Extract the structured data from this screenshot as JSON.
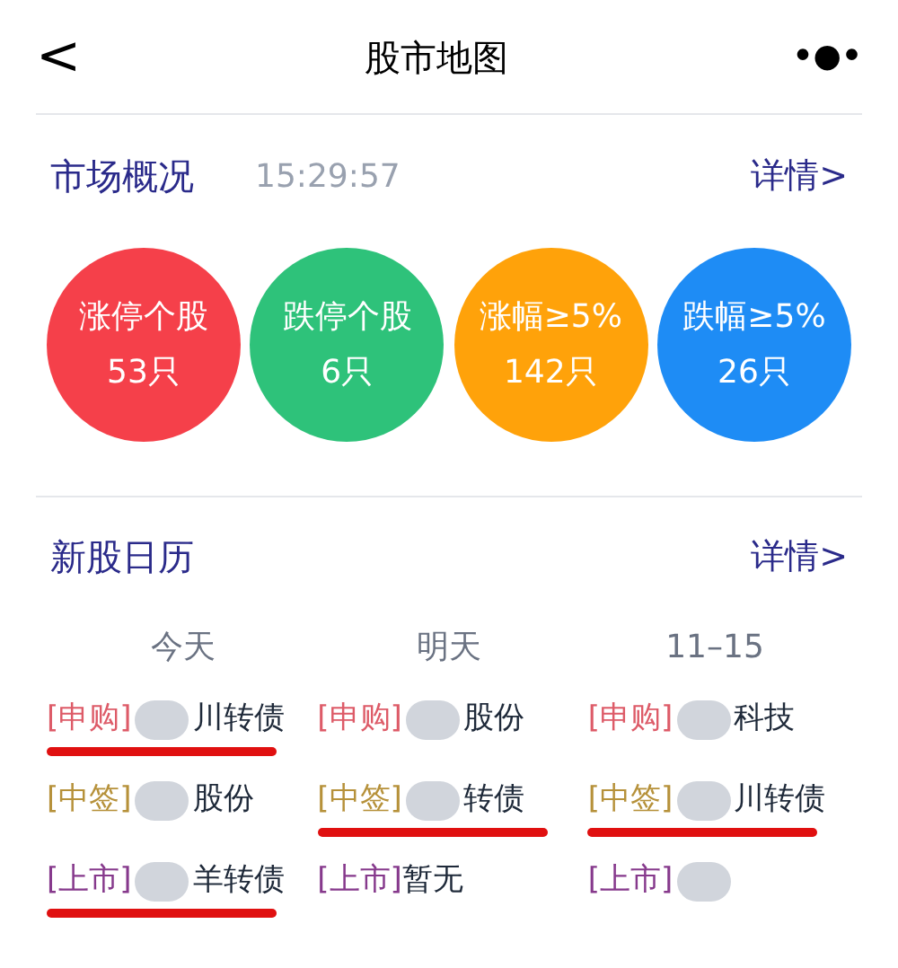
{
  "header": {
    "back": "<",
    "title": "股市地图",
    "more": "•●•"
  },
  "market": {
    "title": "市场概况",
    "time": "15:29:57",
    "detail": "详情>",
    "stats": [
      {
        "label": "涨停个股",
        "count": "53只",
        "color": "#f5404a"
      },
      {
        "label": "跌停个股",
        "count": "6只",
        "color": "#2ec27a"
      },
      {
        "label": "涨幅≥5%",
        "count": "142只",
        "color": "#ffa20a"
      },
      {
        "label": "跌幅≥5%",
        "count": "26只",
        "color": "#1e8cf5"
      }
    ]
  },
  "calendar": {
    "title": "新股日历",
    "detail": "详情>",
    "columns": [
      "今天",
      "明天",
      "11–15"
    ],
    "rows": [
      [
        {
          "tag": "[申购]",
          "color": "#dd5b68",
          "redacted": true,
          "name": "川转债",
          "underlined": true
        },
        {
          "tag": "[申购]",
          "color": "#dd5b68",
          "redacted": true,
          "name": "股份",
          "underlined": false
        },
        {
          "tag": "[申购]",
          "color": "#dd5b68",
          "redacted": true,
          "name": "科技",
          "underlined": false
        }
      ],
      [
        {
          "tag": "[中签]",
          "color": "#b6913a",
          "redacted": true,
          "name": "股份",
          "underlined": false
        },
        {
          "tag": "[中签]",
          "color": "#b6913a",
          "redacted": true,
          "name": "转债",
          "underlined": true
        },
        {
          "tag": "[中签]",
          "color": "#b6913a",
          "redacted": true,
          "name": "川转债",
          "underlined": true
        }
      ],
      [
        {
          "tag": "[上市]",
          "color": "#86398c",
          "redacted": true,
          "name": "羊转债",
          "underlined": true
        },
        {
          "tag": "[上市]",
          "color": "#86398c",
          "redacted": false,
          "name": "暂无",
          "underlined": false
        },
        {
          "tag": "[上市]",
          "color": "#86398c",
          "redacted": true,
          "underlined": false
        }
      ]
    ]
  }
}
